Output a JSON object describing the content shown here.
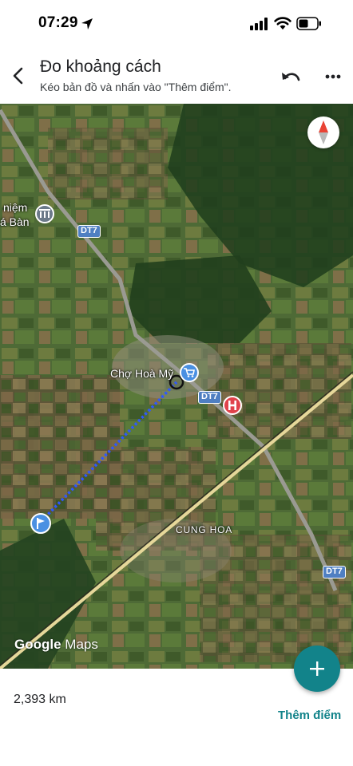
{
  "status_bar": {
    "time": "07:29",
    "icons": [
      "location-arrow-icon",
      "cellular-signal-icon",
      "wifi-icon",
      "battery-icon"
    ]
  },
  "header": {
    "title": "Đo khoảng cách",
    "subtitle": "Kéo bản đồ và nhấn vào \"Thêm điểm\".",
    "icons": [
      "back-arrow-icon",
      "undo-icon",
      "more-vert-icon"
    ]
  },
  "map": {
    "labels": {
      "market": "Chợ Hoà Mỹ",
      "area": "CUNG HOA",
      "memorial_line1": "niệm",
      "memorial_line2": "á Bàn"
    },
    "road_shields": {
      "top": "DT7",
      "middle": "DT7",
      "bottom": "DT7"
    },
    "logo_google": "Google",
    "logo_maps": "Maps",
    "colors": {
      "route": "#2f57ff",
      "shield": "#4f7fc2",
      "hospital": "#e0424b",
      "shop": "#4a90e2",
      "start_marker": "#4a90e2"
    }
  },
  "bottom": {
    "distance": "2,393 km",
    "add_point_label": "Thêm điểm",
    "fab_icon": "plus-icon",
    "accent": "#12838a"
  }
}
